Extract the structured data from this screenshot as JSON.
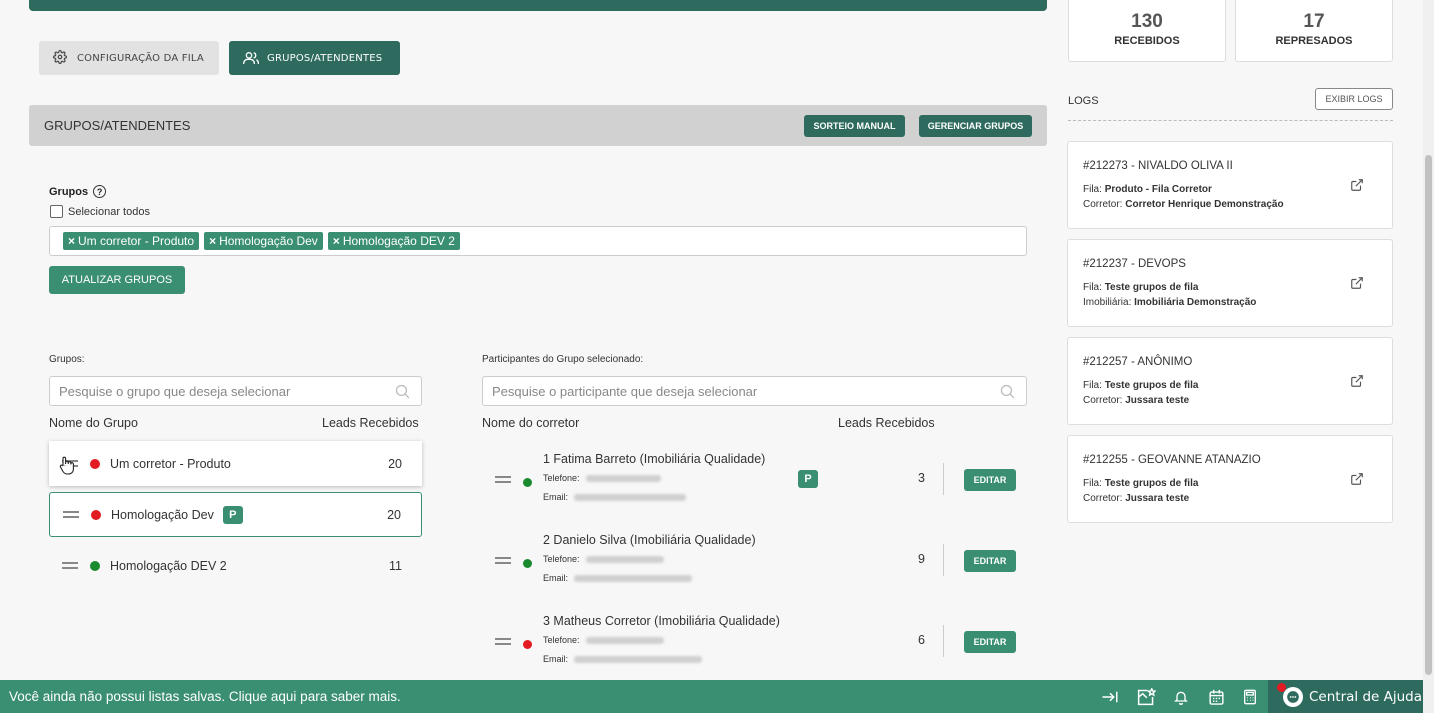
{
  "tabs": {
    "config_label": "CONFIGURAÇÃO DA FILA",
    "grupos_label": "GRUPOS/ATENDENTES"
  },
  "section": {
    "title": "GRUPOS/ATENDENTES",
    "sorteio_label": "SORTEIO MANUAL",
    "gerenciar_label": "GERENCIAR GRUPOS"
  },
  "form": {
    "grupos_label": "Grupos",
    "help_glyph": "?",
    "select_all_label": "Selecionar todos",
    "tags": [
      "Um corretor - Produto",
      "Homologação Dev",
      "Homologação DEV 2"
    ],
    "tag_remove_glyph": "×",
    "update_label": "ATUALIZAR GRUPOS"
  },
  "groups_panel": {
    "label": "Grupos:",
    "search_placeholder": "Pesquise o grupo que deseja selecionar",
    "col_name": "Nome do Grupo",
    "col_leads": "Leads Recebidos",
    "rows": [
      {
        "name": "Um corretor - Produto",
        "leads": "20",
        "status": "red"
      },
      {
        "name": "Homologação Dev",
        "leads": "20",
        "status": "red",
        "badge": "P"
      },
      {
        "name": "Homologação DEV 2",
        "leads": "11",
        "status": "green"
      }
    ]
  },
  "participants_panel": {
    "label": "Participantes do Grupo selecionado:",
    "search_placeholder": "Pesquise o participante que deseja selecionar",
    "col_name": "Nome do corretor",
    "col_leads": "Leads Recebidos",
    "phone_label": "Telefone:",
    "email_label": "Email:",
    "edit_label": "EDITAR",
    "rows": [
      {
        "name": "1 Fatima Barreto (Imobiliária Qualidade)",
        "leads": "3",
        "status": "green",
        "badge": "P"
      },
      {
        "name": "2 Danielo Silva (Imobiliária Qualidade)",
        "leads": "9",
        "status": "green"
      },
      {
        "name": "3 Matheus Corretor (Imobiliária Qualidade)",
        "leads": "6",
        "status": "red"
      }
    ]
  },
  "stats": [
    {
      "value": "130",
      "label": "RECEBIDOS"
    },
    {
      "value": "17",
      "label": "REPRESADOS"
    }
  ],
  "logs": {
    "label": "LOGS",
    "button_label": "EXIBIR LOGS",
    "items": [
      {
        "title": "#212273 - NIVALDO OLIVA II",
        "l1_key": "Fila:",
        "l1_val": "Produto - Fila Corretor",
        "l2_key": "Corretor:",
        "l2_val": "Corretor Henrique Demonstração"
      },
      {
        "title": "#212237 - DEVOPS",
        "l1_key": "Fila:",
        "l1_val": "Teste grupos de fila",
        "l2_key": "Imobiliária:",
        "l2_val": "Imobiliária Demonstração"
      },
      {
        "title": "#212257 - ANÔNIMO",
        "l1_key": "Fila:",
        "l1_val": "Teste grupos de fila",
        "l2_key": "Corretor:",
        "l2_val": "Jussara teste"
      },
      {
        "title": "#212255 - GEOVANNE ATANAZIO",
        "l1_key": "Fila:",
        "l1_val": "Teste grupos de fila",
        "l2_key": "Corretor:",
        "l2_val": "Jussara teste"
      }
    ]
  },
  "bottom": {
    "message": "Você ainda não possui listas salvas. Clique aqui para saber mais.",
    "help_label": "Central de Ajuda"
  },
  "colors": {
    "primary_dark": "#2e6b5e",
    "primary": "#3a8f72",
    "status_red": "#e31b23",
    "status_green": "#1a8a2e"
  },
  "icons": [
    "gear-icon",
    "users-icon",
    "help-circle-icon",
    "search-icon",
    "drag-handle-icon",
    "hand-cursor-icon",
    "external-link-icon",
    "collapse-icon",
    "star-list-icon",
    "bell-icon",
    "calendar-icon",
    "calculator-icon",
    "chat-icon"
  ]
}
